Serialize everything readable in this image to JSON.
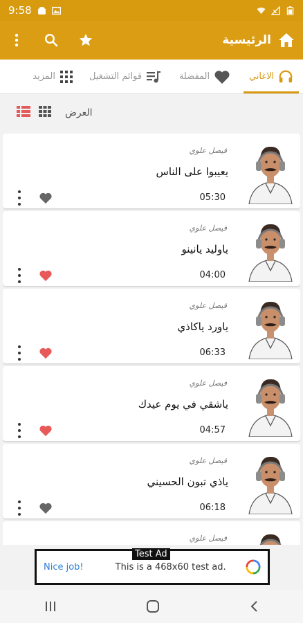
{
  "status": {
    "time": "9:58"
  },
  "appbar": {
    "title": "الرئيسية"
  },
  "tabs": [
    {
      "label": "الاغاني",
      "icon": "headphones-icon"
    },
    {
      "label": "المفضلة",
      "icon": "heart-icon"
    },
    {
      "label": "قوائم التشغيل",
      "icon": "playlist-icon"
    },
    {
      "label": "المزيد",
      "icon": "grid-icon"
    }
  ],
  "view": {
    "label": "العرض"
  },
  "songs": [
    {
      "artist": "فيصل علوي",
      "title": "يعيبوا على الناس",
      "duration": "05:30",
      "favorite": false
    },
    {
      "artist": "فيصل علوي",
      "title": "ياوليد يانينو",
      "duration": "04:00",
      "favorite": true
    },
    {
      "artist": "فيصل علوي",
      "title": "ياورد ياكاذي",
      "duration": "06:33",
      "favorite": true
    },
    {
      "artist": "فيصل علوي",
      "title": "ياشقي في يوم عيدك",
      "duration": "04:57",
      "favorite": true
    },
    {
      "artist": "فيصل علوي",
      "title": "ياذي تبون الحسيني",
      "duration": "06:18",
      "favorite": false
    },
    {
      "artist": "فيصل علوي",
      "title": "",
      "duration": "",
      "favorite": false
    }
  ],
  "ad": {
    "badge": "Test Ad",
    "cta": "Nice job!",
    "text": "This is a 468x60 test ad."
  },
  "colors": {
    "accent": "#d99a12",
    "appbar": "#db9d14",
    "heart_on": "#e85a5a",
    "heart_off": "#666666"
  }
}
